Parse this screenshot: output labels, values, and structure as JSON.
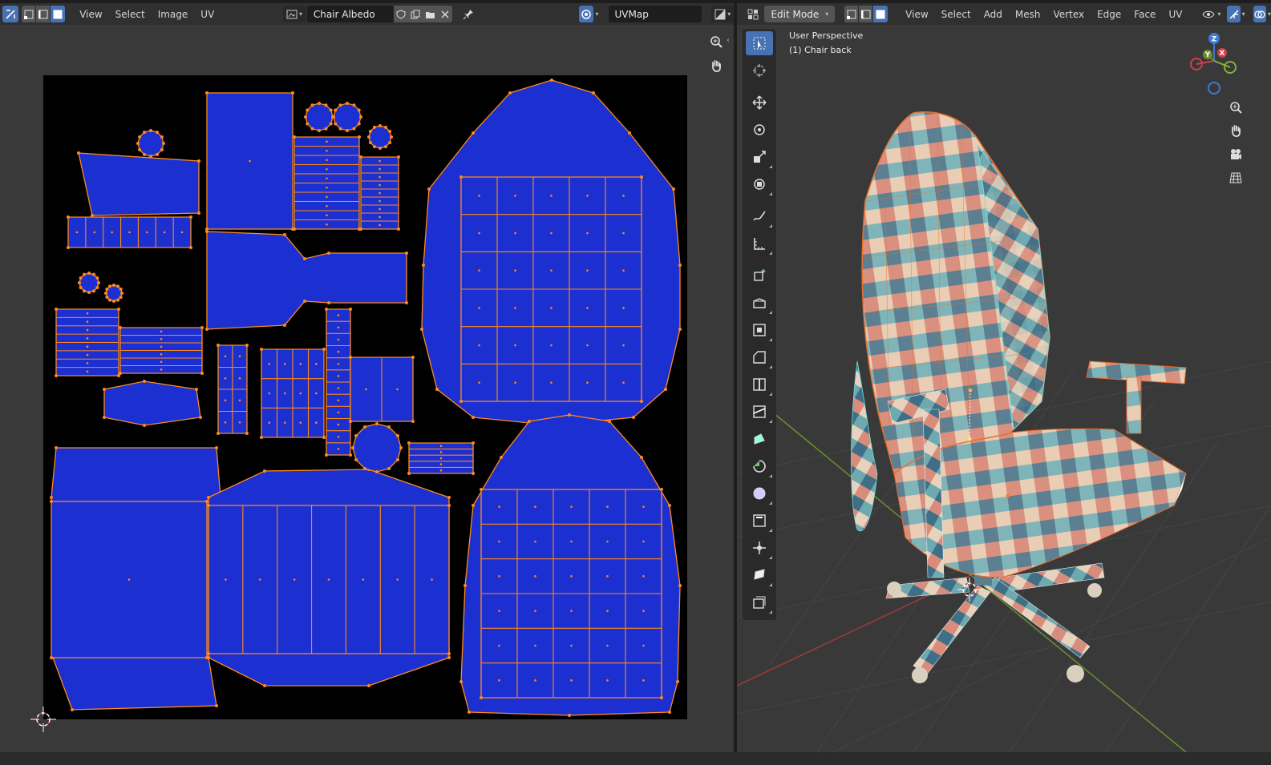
{
  "uv_header": {
    "menus": [
      "View",
      "Select",
      "Image",
      "UV"
    ],
    "image_name": "Chair Albedo",
    "uv_map": "UVMap"
  },
  "viewport_header": {
    "mode": "Edit Mode",
    "menus": [
      "View",
      "Select",
      "Add",
      "Mesh",
      "Vertex",
      "Edge",
      "Face",
      "UV"
    ]
  },
  "viewport": {
    "perspective_label": "User Perspective",
    "object_label": "(1) Chair back"
  },
  "gizmo": {
    "z_label": "Z",
    "y_label": "Y",
    "x_label": "X"
  },
  "toolbar_tools": [
    "select-box",
    "cursor",
    "move",
    "rotate",
    "scale",
    "transform",
    "annotate",
    "measure",
    "add-cube",
    "extrude-region",
    "inset-faces",
    "bevel",
    "loop-cut",
    "knife",
    "poly-build",
    "spin",
    "smooth",
    "edge-slide",
    "shrink-fatten",
    "shear",
    "rip-region"
  ],
  "colors": {
    "uv_island_fill": "#1c2fd0",
    "uv_edge": "#ff8a1a",
    "uv_background": "#000000",
    "active_button": "#4772b3",
    "editor_background": "#393939",
    "header_background": "#303030"
  }
}
